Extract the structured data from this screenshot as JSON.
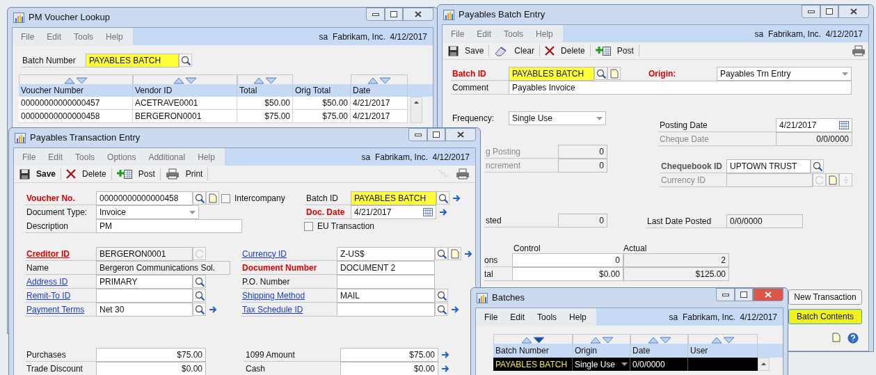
{
  "voucher_lookup": {
    "title": "PM Voucher Lookup",
    "active": false,
    "menu": [
      "File",
      "Edit",
      "Tools",
      "Help"
    ],
    "user_info": "sa  Fabrikam, Inc.  4/12/2017",
    "batch_number": {
      "label": "Batch Number",
      "value": "PAYABLES BATCH",
      "highlighted": true
    },
    "columns": [
      {
        "label": "Voucher Number",
        "sort_arrows": true
      },
      {
        "label": "Vendor ID",
        "sort_arrows": true
      },
      {
        "label": "Total",
        "sort_arrows": true
      },
      {
        "label": "Orig Total",
        "sort_arrows": false
      },
      {
        "label": "Date",
        "sort_arrows": true
      }
    ],
    "rows": [
      [
        "00000000000000457",
        "ACETRAVE0001",
        "$50.00",
        "$50.00",
        "4/21/2017"
      ],
      [
        "00000000000000458",
        "BERGERON0001",
        "$75.00",
        "$75.00",
        "4/21/2017"
      ]
    ]
  },
  "batch_entry": {
    "title": "Payables Batch Entry",
    "active": false,
    "menu": [
      "File",
      "Edit",
      "Tools",
      "Help"
    ],
    "user_info": "sa  Fabrikam, Inc.  4/12/2017",
    "toolbar": [
      {
        "kind": "save",
        "label": "Save",
        "bold": false
      },
      {
        "kind": "clear",
        "label": "Clear",
        "bold": false
      },
      {
        "kind": "delete",
        "label": "Delete",
        "bold": false
      },
      {
        "kind": "post",
        "label": "Post",
        "bold": false
      }
    ],
    "batch_id": {
      "label": "Batch ID",
      "required": true,
      "link": false,
      "disabled": false,
      "kind": "input",
      "value": "PAYABLES BATCH",
      "highlighted": true
    },
    "origin": {
      "label": "Origin:",
      "required": true,
      "link": false,
      "disabled": false,
      "kind": "dropdown",
      "value": "Payables Trn Entry",
      "highlighted": false
    },
    "comment": {
      "label": "Comment",
      "required": false,
      "link": false,
      "disabled": false,
      "kind": "input",
      "value": "Payables Invoice",
      "highlighted": false
    },
    "left_fields": [
      {
        "label": "Frequency:",
        "required": false,
        "link": false,
        "disabled": false,
        "kind": "dropdown",
        "value": "Single Use",
        "highlighted": false
      },
      {
        "label": "g Posting",
        "required": false,
        "link": false,
        "disabled": true,
        "kind": "readonly",
        "value": "0",
        "highlighted": false
      },
      {
        "label": "ncrement",
        "required": false,
        "link": false,
        "disabled": true,
        "kind": "readonly",
        "value": "0",
        "highlighted": false
      }
    ],
    "right_fields": [
      {
        "label": "Posting Date",
        "required": false,
        "link": false,
        "disabled": false,
        "kind": "input",
        "value": "4/21/2017",
        "highlighted": false
      },
      {
        "label": "Cheque Date",
        "required": false,
        "link": false,
        "disabled": true,
        "kind": "readonly",
        "value": "0/0/0000",
        "highlighted": false
      }
    ],
    "chequebook_id": {
      "label": "Chequebook ID",
      "required": true,
      "link": false,
      "disabled": true,
      "kind": "input",
      "value": "UPTOWN TRUST",
      "highlighted": false
    },
    "currency_id": {
      "label": "Currency ID",
      "required": false,
      "link": false,
      "disabled": true,
      "kind": "readonly",
      "highlighted": false
    },
    "posted": {
      "label": "sted",
      "required": false,
      "link": false,
      "disabled": false,
      "kind": "readonly",
      "value": "0",
      "highlighted": false
    },
    "last_date_posted": {
      "label": "Last Date Posted",
      "required": false,
      "link": false,
      "disabled": false,
      "kind": "readonly",
      "value": "0/0/0000",
      "highlighted": false
    },
    "totals": {
      "headers": [
        "Control",
        "Actual"
      ],
      "rows": [
        {
          "label": "ons",
          "control": "0",
          "actual": "2"
        },
        {
          "label": "tal",
          "control": "$0.00",
          "actual": "$125.00"
        }
      ]
    },
    "buttons": [
      {
        "label": "New Transaction",
        "highlighted": false
      },
      {
        "label": "Batch Contents",
        "highlighted": true
      }
    ]
  },
  "transaction_entry": {
    "title": "Payables Transaction Entry",
    "active": false,
    "menu": [
      "File",
      "Edit",
      "Tools",
      "Options",
      "Additional",
      "Help"
    ],
    "user_info": "sa  Fabrikam, Inc.  4/12/2017",
    "toolbar": [
      {
        "kind": "save",
        "label": "Save",
        "bold": true
      },
      {
        "kind": "delete",
        "label": "Delete",
        "bold": false
      },
      {
        "kind": "post",
        "label": "Post",
        "bold": false
      },
      {
        "kind": "print",
        "label": "Print",
        "bold": false
      }
    ],
    "voucher_no": {
      "label": "Voucher No.",
      "required": true,
      "link": false,
      "disabled": false,
      "kind": "input",
      "value": "00000000000000458",
      "highlighted": false
    },
    "document_type": {
      "label": "Document Type:",
      "required": false,
      "link": false,
      "disabled": false,
      "kind": "dropdown",
      "value": "Invoice",
      "highlighted": false
    },
    "description": {
      "label": "Description",
      "required": false,
      "link": false,
      "disabled": false,
      "kind": "input",
      "value": "PM",
      "highlighted": false
    },
    "intercompany": {
      "label": "Intercompany",
      "checked": false
    },
    "batch_id": {
      "label": "Batch ID",
      "required": false,
      "link": false,
      "disabled": false,
      "kind": "input",
      "value": "PAYABLES BATCH",
      "highlighted": true
    },
    "doc_date": {
      "label": "Doc. Date",
      "required": true,
      "link": false,
      "disabled": false,
      "kind": "input",
      "value": "4/21/2017",
      "highlighted": false
    },
    "eu_transaction": {
      "label": "EU Transaction",
      "checked": false
    },
    "vendor_left": [
      {
        "label": "Creditor ID",
        "required": true,
        "link": true,
        "disabled": false,
        "kind": "readonly",
        "value": "BERGERON0001",
        "highlighted": false
      },
      {
        "label": "Name",
        "required": false,
        "link": false,
        "disabled": false,
        "kind": "readonly",
        "value": "Bergeron Communications Sol.",
        "highlighted": false
      },
      {
        "label": "Address ID",
        "required": false,
        "link": true,
        "disabled": false,
        "kind": "input",
        "value": "PRIMARY",
        "highlighted": false
      },
      {
        "label": "Remit-To ID",
        "required": false,
        "link": true,
        "disabled": false,
        "kind": "input",
        "highlighted": false
      },
      {
        "label": "Payment Terms",
        "required": false,
        "link": true,
        "disabled": false,
        "kind": "input",
        "value": "Net 30",
        "highlighted": false
      }
    ],
    "vendor_right": [
      {
        "label": "Currency ID",
        "required": false,
        "link": true,
        "disabled": false,
        "kind": "input",
        "value": "Z-US$",
        "highlighted": false
      },
      {
        "label": "Document Number",
        "required": true,
        "link": false,
        "disabled": false,
        "kind": "input",
        "value": "DOCUMENT 2",
        "highlighted": false
      },
      {
        "label": "P.O. Number",
        "required": false,
        "link": false,
        "disabled": false,
        "kind": "input",
        "highlighted": false
      },
      {
        "label": "Shipping Method",
        "required": false,
        "link": true,
        "disabled": false,
        "kind": "input",
        "value": "MAIL",
        "highlighted": false
      },
      {
        "label": "Tax Schedule ID",
        "required": false,
        "link": true,
        "disabled": false,
        "kind": "input",
        "highlighted": false
      }
    ],
    "amounts_left": [
      {
        "label": "Purchases",
        "required": false,
        "link": false,
        "disabled": false,
        "kind": "input",
        "value": "$75.00",
        "highlighted": false
      },
      {
        "label": "Trade Discount",
        "required": false,
        "link": false,
        "disabled": false,
        "kind": "input",
        "value": "$0.00",
        "highlighted": false
      }
    ],
    "amounts_right": [
      {
        "label": "1099 Amount",
        "required": false,
        "link": false,
        "disabled": false,
        "kind": "input",
        "value": "$75.00",
        "highlighted": false
      },
      {
        "label": "Cash",
        "required": false,
        "link": false,
        "disabled": false,
        "kind": "input",
        "value": "$0.00",
        "highlighted": false
      }
    ]
  },
  "batches": {
    "title": "Batches",
    "active": true,
    "menu": [
      "File",
      "Edit",
      "Tools",
      "Help"
    ],
    "user_info": "sa  Fabrikam, Inc.  4/12/2017",
    "columns": [
      {
        "label": "Batch Number",
        "sorted": true
      },
      {
        "label": "Origin",
        "sorted": false
      },
      {
        "label": "Date",
        "sorted": false
      },
      {
        "label": "User",
        "sorted": false
      }
    ],
    "rows": [
      {
        "cells": [
          "PAYABLES BATCH",
          "Single Use",
          "0/0/0000"
        ],
        "selected": true,
        "highlighted": true
      }
    ]
  }
}
